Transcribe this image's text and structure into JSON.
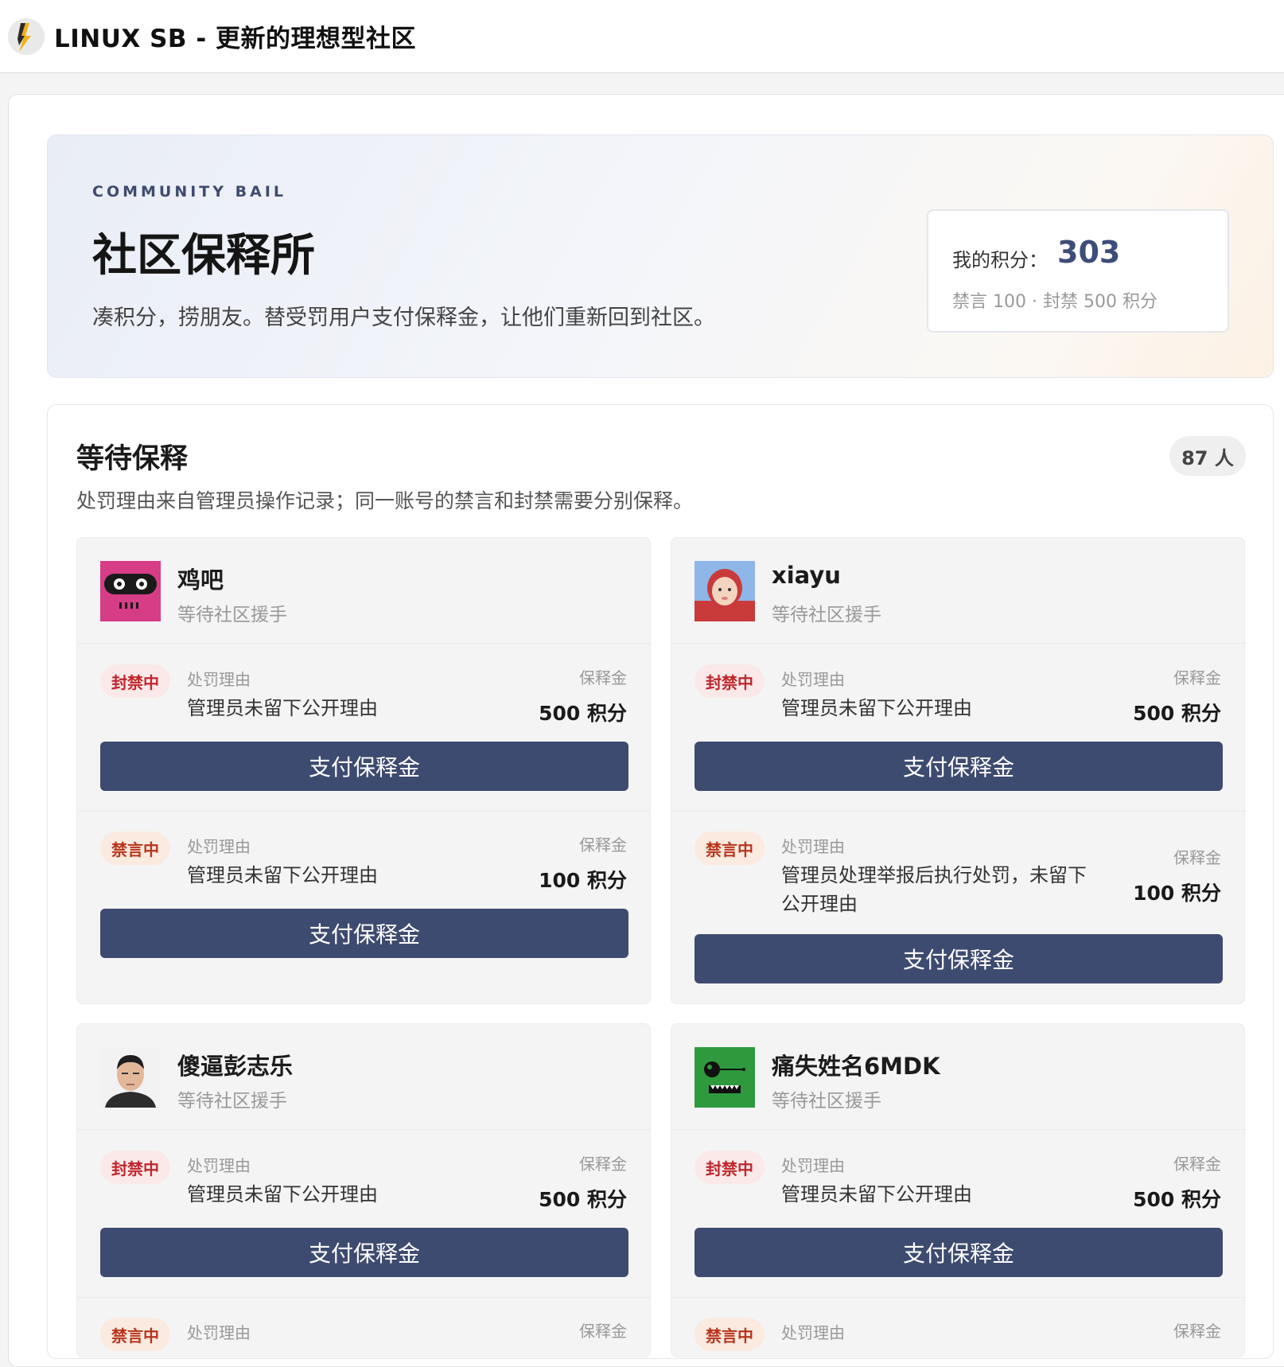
{
  "site": {
    "title": "LINUX SB - 更新的理想型社区"
  },
  "hero": {
    "eyebrow": "COMMUNITY BAIL",
    "title": "社区保释所",
    "subtitle": "凑积分，捞朋友。替受罚用户支付保释金，让他们重新回到社区。",
    "points_label": "我的积分：",
    "points_value": "303",
    "points_rule": "禁言 100 · 封禁 500 积分"
  },
  "waiting": {
    "title": "等待保释",
    "description": "处罚理由来自管理员操作记录；同一账号的禁言和封禁需要分别保释。",
    "count": "87 人"
  },
  "labels": {
    "reason": "处罚理由",
    "bail": "保释金",
    "pay": "支付保释金",
    "status_waiting": "等待社区援手",
    "tag_ban": "封禁中",
    "tag_mute": "禁言中"
  },
  "users": [
    {
      "name": "鸡吧",
      "status": "等待社区援手",
      "avatar": "robot-pink",
      "penalties": [
        {
          "tag": "封禁中",
          "reason": "管理员未留下公开理由",
          "amount": "500 积分",
          "button": "支付保释金"
        },
        {
          "tag": "禁言中",
          "reason": "管理员未留下公开理由",
          "amount": "100 积分",
          "button": "支付保释金"
        }
      ]
    },
    {
      "name": "xiayu",
      "status": "等待社区援手",
      "avatar": "child-photo",
      "penalties": [
        {
          "tag": "封禁中",
          "reason": "管理员未留下公开理由",
          "amount": "500 积分",
          "button": "支付保释金"
        },
        {
          "tag": "禁言中",
          "reason": "管理员处理举报后执行处罚，未留下公开理由",
          "amount": "100 积分",
          "button": "支付保释金"
        }
      ]
    },
    {
      "name": "傻逼彭志乐",
      "status": "等待社区援手",
      "avatar": "man-photo",
      "penalties": [
        {
          "tag": "封禁中",
          "reason": "管理员未留下公开理由",
          "amount": "500 积分",
          "button": "支付保释金"
        },
        {
          "tag": "禁言中",
          "reason": "处罚理由",
          "amount": "",
          "button": ""
        }
      ]
    },
    {
      "name": "痛失姓名6MDK",
      "status": "等待社区援手",
      "avatar": "monster-green",
      "penalties": [
        {
          "tag": "封禁中",
          "reason": "管理员未留下公开理由",
          "amount": "500 积分",
          "button": "支付保释金"
        },
        {
          "tag": "禁言中",
          "reason": "处罚理由",
          "amount": "",
          "button": ""
        }
      ]
    }
  ],
  "colors": {
    "accent": "#3e4b70",
    "points": "#3d4d79",
    "ban_text": "#c0262c",
    "mute_text": "#b8341c"
  }
}
